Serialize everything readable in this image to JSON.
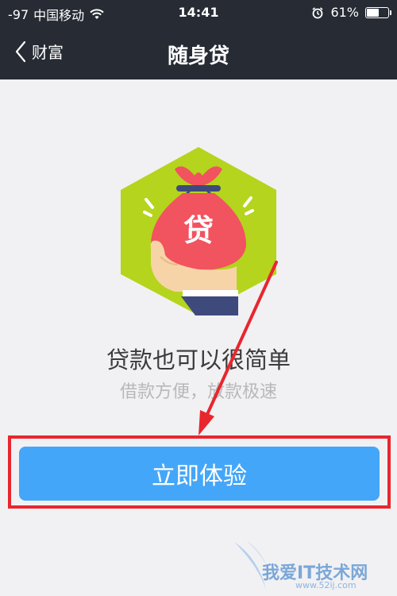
{
  "status_bar": {
    "signal": "-97",
    "carrier": "中国移动",
    "time": "14:41",
    "battery_text": "61%",
    "battery_level": 0.61,
    "icons": [
      "wifi-icon",
      "alarm-icon",
      "battery-icon"
    ]
  },
  "nav": {
    "back_label": "财富",
    "title": "随身贷"
  },
  "hero": {
    "bag_label": "贷",
    "colors": {
      "hexagon": "#b5d41d",
      "bag": "#f1535f",
      "hand": "#f7d4a8",
      "sleeve": "#3e4a7c"
    }
  },
  "content": {
    "headline": "贷款也可以很简单",
    "subline": "借款方便，放款极速"
  },
  "cta": {
    "label": "立即体验",
    "color": "#44a6f8"
  },
  "annotation": {
    "color": "#e8262e"
  },
  "watermark": {
    "text": "我爱IT技术网",
    "url": "www.52ij.com"
  }
}
